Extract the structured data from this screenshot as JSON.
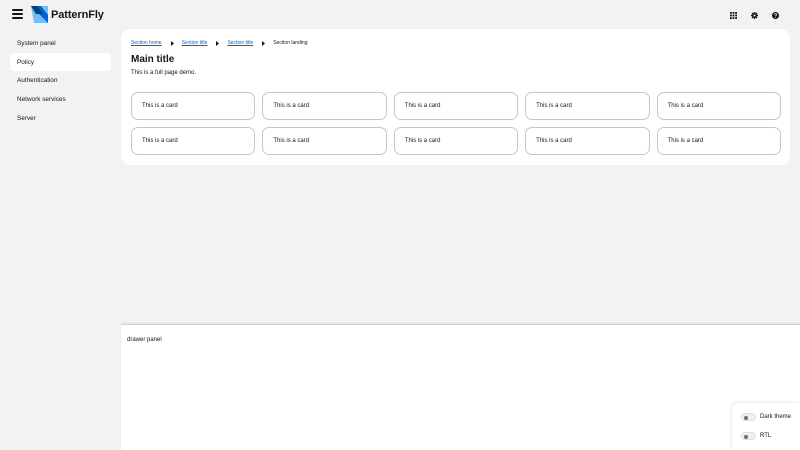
{
  "masthead": {
    "brand": "PatternFly",
    "brand_colors": {
      "dark": "#004080",
      "mid": "#0066cc",
      "light": "#73bcf7"
    },
    "tools": [
      {
        "icon": "apps-grid-icon"
      },
      {
        "icon": "gear-icon"
      },
      {
        "icon": "question-circle-icon"
      }
    ]
  },
  "sidebar": {
    "items": [
      {
        "label": "System panel",
        "active": false
      },
      {
        "label": "Policy",
        "active": true
      },
      {
        "label": "Authentication",
        "active": false
      },
      {
        "label": "Network services",
        "active": false
      },
      {
        "label": "Server",
        "active": false
      }
    ]
  },
  "main": {
    "breadcrumb": {
      "links": [
        "Section home",
        "Section title",
        "Section title"
      ],
      "current": "Section landing"
    },
    "title": "Main title",
    "description": "This is a full page demo.",
    "cards": [
      "This is a card",
      "This is a card",
      "This is a card",
      "This is a card",
      "This is a card",
      "This is a card",
      "This is a card",
      "This is a card",
      "This is a card",
      "This is a card"
    ]
  },
  "drawer": {
    "text": "drawer panel"
  },
  "toggles": {
    "dark_theme": "Dark theme",
    "rtl": "RTL"
  }
}
